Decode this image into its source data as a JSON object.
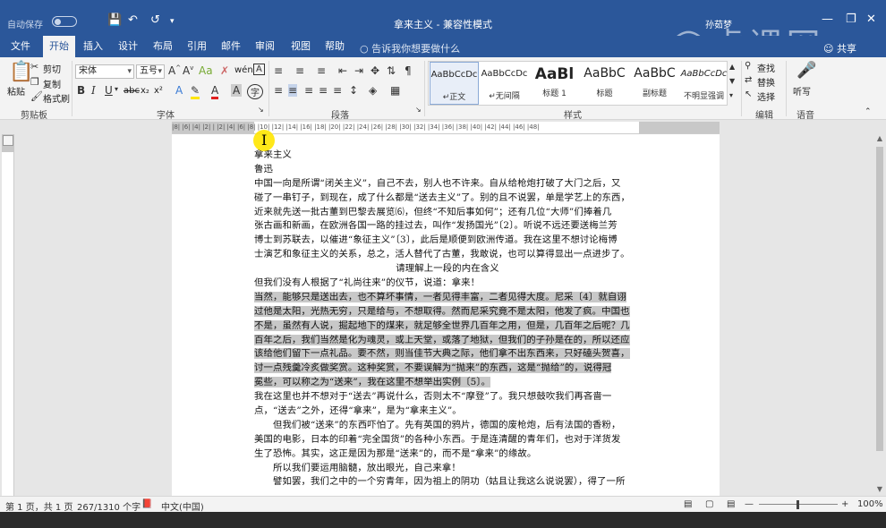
{
  "titlebar": {
    "autosave_label": "自动保存",
    "autosave_state": "关",
    "title": "拿来主义 - 兼容性模式",
    "user": "孙茹梦",
    "watermark": "虎课网"
  },
  "ribbon_tabs": [
    "文件",
    "开始",
    "插入",
    "设计",
    "布局",
    "引用",
    "邮件",
    "审阅",
    "视图",
    "帮助"
  ],
  "active_tab": "开始",
  "tell_me": "告诉我你想要做什么",
  "share": "共享",
  "clipboard": {
    "paste": "粘贴",
    "cut": "剪切",
    "copy": "复制",
    "format_painter": "格式刷",
    "label": "剪贴板"
  },
  "font": {
    "name": "宋体",
    "size": "五号",
    "label": "字体",
    "phonetic_btn": "wén",
    "subscript": "x₂",
    "superscript": "x²"
  },
  "paragraph": {
    "label": "段落"
  },
  "styles": {
    "label": "样式",
    "items": [
      {
        "preview": "AaBbCcDc",
        "name": "↵正文"
      },
      {
        "preview": "AaBbCcDc",
        "name": "↵无间隔"
      },
      {
        "preview": "AaBl",
        "name": "标题 1"
      },
      {
        "preview": "AaBbC",
        "name": "标题"
      },
      {
        "preview": "AaBbC",
        "name": "副标题"
      },
      {
        "preview": "AaBbCcDc",
        "name": "不明显强调"
      }
    ]
  },
  "editing": {
    "find": "查找",
    "replace": "替换",
    "select": "选择",
    "label": "编辑"
  },
  "voice": {
    "dictate": "听写",
    "label": "语音"
  },
  "ruler_numbers": "|8| |6| |4| |2| | |2| |4| |6| |8| |10| |12| |14| |16| |18| |20| |22| |24| |26| |28| |30| |32| |34| |36| |38| |40| |42| |44| |46| |48|",
  "document": {
    "lines": [
      {
        "t": "拿来主义",
        "s": ""
      },
      {
        "t": "鲁迅",
        "s": ""
      },
      {
        "t": "中国一向是所谓“闭关主义”，自己不去，别人也不许来。自从给枪炮打破了大门之后，又",
        "s": ""
      },
      {
        "t": "碰了一串钉子，到现在，成了什么都是“送去主义”了。别的且不说罢，单是学艺上的东西，",
        "s": ""
      },
      {
        "t": "近来就先送一批古董到巴黎去展览⑹，但终“不知后事如何”；还有几位“大师”们捧着几",
        "s": ""
      },
      {
        "t": "张古画和新画，在欧洲各国一路的挂过去，叫作“发扬国光”〔2〕。听说不远还要送梅兰芳",
        "s": ""
      },
      {
        "t": "博士到苏联去，以催进“象征主义”〔3〕，此后是顺便到欧洲传道。我在这里不想讨论梅博",
        "s": ""
      },
      {
        "t": "士演艺和象征主义的关系，总之，活人替代了古董，我敢说，也可以算得显出一点进步了。",
        "s": ""
      },
      {
        "t": "请理解上一段的内在含义",
        "s": "c"
      },
      {
        "t": "但我们没有人根据了“礼尚往来”的仪节，说道：拿来！",
        "s": ""
      },
      {
        "t": "当然，能够只是送出去，也不算坏事情，一者见得丰富，二者见得大度。尼采〔4〕就自诩",
        "s": "hl"
      },
      {
        "t": "过他是太阳，光热无穷，只是给与，不想取得。然而尼采究竟不是太阳，他发了疯。中国也",
        "s": "hl"
      },
      {
        "t": "不是，虽然有人说，掘起地下的煤来，就足够全世界几百年之用，但是，几百年之后呢？几",
        "s": "hl"
      },
      {
        "t": "百年之后，我们当然是化为魂灵，或上天堂，或落了地狱，但我们的子孙是在的，所以还应",
        "s": "hl"
      },
      {
        "t": "该给他们留下一点礼品。要不然，则当佳节大典之际，他们拿不出东西来，只好磕头贺喜，",
        "s": "hl"
      },
      {
        "t": "讨一点残羹冷炙做奖赏。这种奖赏，不要误解为“抛来”的东西，这是“抛给”的，说得冠",
        "s": "hl"
      },
      {
        "t": "冕些，可以称之为“送来”，我在这里不想举出实例〔5〕。",
        "s": "hl"
      },
      {
        "t": "我在这里也并不想对于“送去”再说什么，否则太不“摩登”了。我只想鼓吹我们再吝啬一",
        "s": ""
      },
      {
        "t": "点，“送去”之外，还得“拿来”，是为“拿来主义”。",
        "s": ""
      },
      {
        "t": "但我们被“送来”的东西吓怕了。先有英国的鸦片，德国的废枪炮，后有法国的香粉，",
        "s": "ind"
      },
      {
        "t": "美国的电影，日本的印着“完全国货”的各种小东西。于是连清醒的青年们，也对于洋货发",
        "s": ""
      },
      {
        "t": "生了恐怖。其实，这正是因为那是“送来”的，而不是“拿来”的缘故。",
        "s": ""
      },
      {
        "t": "所以我们要运用脑髓，放出眼光，自己来拿！",
        "s": "ind"
      },
      {
        "t": "譬如罢，我们之中的一个穷青年，因为祖上的阴功（姑且让我这么说说罢），得了一所",
        "s": "ind"
      }
    ]
  },
  "status": {
    "page": "第 1 页，共 1 页",
    "words": "267/1310 个字",
    "lang": "中文(中国)",
    "zoom": "100%"
  }
}
